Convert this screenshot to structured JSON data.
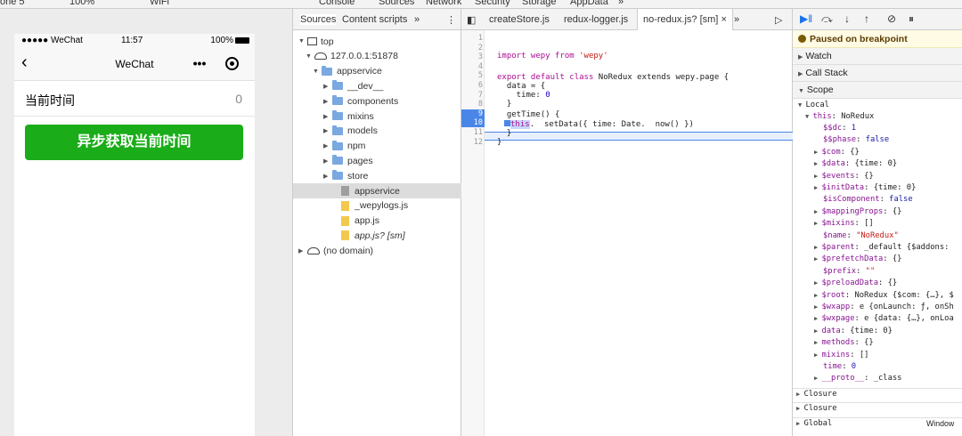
{
  "topstrip": {
    "device": "one 5",
    "zoom": "100%",
    "network": "WiFi",
    "tabs": [
      "Console",
      "Sources",
      "Network",
      "Security",
      "Storage",
      "AppData",
      "»"
    ]
  },
  "simulator": {
    "status": {
      "carrier": "●●●●● WeChat",
      "time": "11:57",
      "battery": "100%"
    },
    "nav_title": "WeChat",
    "capsule_dots": "•••",
    "time_label": "当前时间",
    "time_value": "0",
    "button_label": "异步获取当前时间"
  },
  "sources": {
    "tabs": [
      "Sources",
      "Content scripts",
      "»"
    ],
    "tree": [
      {
        "label": "top",
        "type": "frame",
        "arrow": "▼"
      },
      {
        "label": "127.0.0.1:51878",
        "type": "cloud",
        "arrow": "▼"
      },
      {
        "label": "appservice",
        "type": "folder",
        "arrow": "▼"
      },
      {
        "label": "__dev__",
        "type": "folder",
        "arrow": "▶"
      },
      {
        "label": "components",
        "type": "folder",
        "arrow": "▶"
      },
      {
        "label": "mixins",
        "type": "folder",
        "arrow": "▶"
      },
      {
        "label": "models",
        "type": "folder",
        "arrow": "▶"
      },
      {
        "label": "npm",
        "type": "folder",
        "arrow": "▶"
      },
      {
        "label": "pages",
        "type": "folder",
        "arrow": "▶"
      },
      {
        "label": "store",
        "type": "folder",
        "arrow": "▶"
      },
      {
        "label": "appservice",
        "type": "file-gray",
        "arrow": ""
      },
      {
        "label": "_wepylogs.js",
        "type": "file",
        "arrow": ""
      },
      {
        "label": "app.js",
        "type": "file",
        "arrow": ""
      },
      {
        "label": "app.js? [sm]",
        "type": "file",
        "arrow": ""
      },
      {
        "label": "(no domain)",
        "type": "cloud",
        "arrow": "▶"
      }
    ]
  },
  "editor": {
    "tabs": [
      "createStore.js",
      "redux-logger.js",
      "no-redux.js? [sm]",
      "×",
      "»"
    ],
    "lines": [
      "1",
      "2",
      "3",
      "4",
      "5",
      "6",
      "7",
      "8",
      "9",
      "10",
      "11",
      "12"
    ],
    "code": {
      "l2a": "import wepy from ",
      "l2b": "'wepy'",
      "l4a": "export default class ",
      "l4b": "NoRedux extends wepy.page {",
      "l5": "  data = {",
      "l6a": "    time: ",
      "l6b": "0",
      "l7": "  }",
      "l8": "  getTime() {",
      "l9a": "this",
      "l9b": ".  setData({ time: Date.  now() })",
      "l10": "  }",
      "l11": "}"
    }
  },
  "debugger": {
    "paused": "Paused on breakpoint",
    "sections": [
      "Watch",
      "Call Stack",
      "Scope"
    ],
    "local": "Local",
    "this_line": "this: NoRedux",
    "props": [
      {
        "k": "$$dc",
        "v": "1",
        "t": "num",
        "exp": false
      },
      {
        "k": "$$phase",
        "v": "false",
        "t": "num",
        "exp": false
      },
      {
        "k": "$com",
        "v": "{}",
        "t": "obj",
        "exp": true
      },
      {
        "k": "$data",
        "v": "{time: 0}",
        "t": "obj",
        "exp": true
      },
      {
        "k": "$events",
        "v": "{}",
        "t": "obj",
        "exp": true
      },
      {
        "k": "$initData",
        "v": "{time: 0}",
        "t": "obj",
        "exp": true
      },
      {
        "k": "$isComponent",
        "v": "false",
        "t": "num",
        "exp": false
      },
      {
        "k": "$mappingProps",
        "v": "{}",
        "t": "obj",
        "exp": true
      },
      {
        "k": "$mixins",
        "v": "[]",
        "t": "obj",
        "exp": true
      },
      {
        "k": "$name",
        "v": "\"NoRedux\"",
        "t": "str",
        "exp": false
      },
      {
        "k": "$parent",
        "v": "_default {$addons:",
        "t": "obj",
        "exp": true
      },
      {
        "k": "$prefetchData",
        "v": "{}",
        "t": "obj",
        "exp": true
      },
      {
        "k": "$prefix",
        "v": "\"\"",
        "t": "str",
        "exp": false
      },
      {
        "k": "$preloadData",
        "v": "{}",
        "t": "obj",
        "exp": true
      },
      {
        "k": "$root",
        "v": "NoRedux {$com: {…}, $",
        "t": "obj",
        "exp": true
      },
      {
        "k": "$wxapp",
        "v": "e {onLaunch: ƒ, onSh",
        "t": "obj",
        "exp": true
      },
      {
        "k": "$wxpage",
        "v": "e {data: {…}, onLoa",
        "t": "obj",
        "exp": true
      },
      {
        "k": "data",
        "v": "{time: 0}",
        "t": "obj",
        "exp": true
      },
      {
        "k": "methods",
        "v": "{}",
        "t": "obj",
        "exp": true
      },
      {
        "k": "mixins",
        "v": "[]",
        "t": "obj",
        "exp": true
      },
      {
        "k": "time",
        "v": "0",
        "t": "num",
        "exp": false
      },
      {
        "k": "__proto__",
        "v": "_class",
        "t": "obj",
        "exp": true
      }
    ],
    "closures": [
      "Closure",
      "Closure",
      "Global"
    ],
    "global_value": "Window"
  }
}
